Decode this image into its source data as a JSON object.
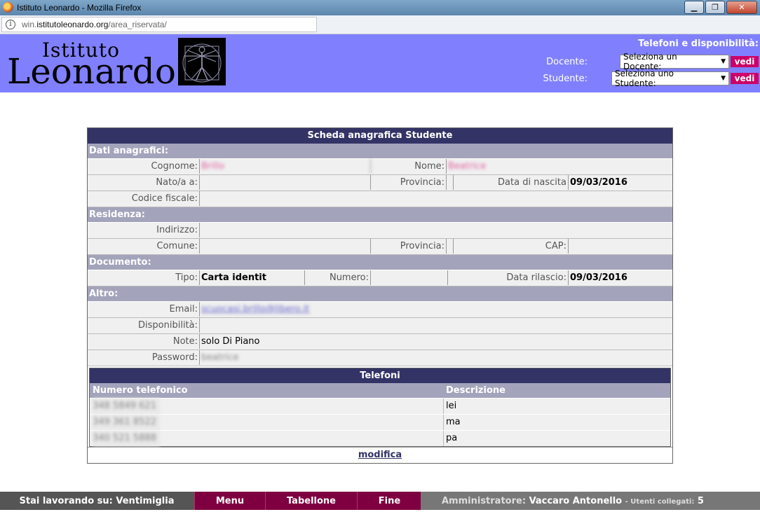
{
  "window": {
    "title": "Istituto Leonardo - Mozilla Firefox",
    "buttons": {
      "minimize": "▁",
      "maximize": "❐",
      "close": "✕"
    }
  },
  "addressbar": {
    "url_prefix": "win.",
    "url_domain": "istitutoleonardo.org",
    "url_path": "/area_riservata/"
  },
  "header": {
    "logo_line1": "Istituto",
    "logo_line2": "Leonardo",
    "title": "Telefoni e disponibilità:",
    "docente_label": "Docente:",
    "docente_select": "Seleziona un Docente:",
    "studente_label": "Studente:",
    "studente_select": "Seleziona uno Studente:",
    "vedi_label": "vedi"
  },
  "card": {
    "title": "Scheda anagrafica Studente",
    "sections": {
      "anagrafici": "Dati anagrafici:",
      "residenza": "Residenza:",
      "documento": "Documento:",
      "altro": "Altro:"
    },
    "labels": {
      "cognome": "Cognome:",
      "nome": "Nome:",
      "nato": "Nato/a a:",
      "provincia": "Provincia:",
      "data_nascita": "Data di nascita",
      "codice_fiscale": "Codice fiscale:",
      "indirizzo": "Indirizzo:",
      "comune": "Comune:",
      "cap": "CAP:",
      "tipo": "Tipo:",
      "numero": "Numero:",
      "data_rilascio": "Data rilascio:",
      "email": "Email:",
      "disponibilita": "Disponibilità:",
      "note": "Note:",
      "password": "Password:"
    },
    "values": {
      "cognome": "Brillo",
      "nome": "Beatrice",
      "data_nascita": "09/03/2016",
      "tipo": "Carta identit",
      "data_rilascio": "09/03/2016",
      "email": "scuocasi.brillo@libero.it",
      "note": "solo Di Piano",
      "password": "beatrice"
    },
    "phones": {
      "title": "Telefoni",
      "col_number": "Numero telefonico",
      "col_desc": "Descrizione",
      "rows": [
        {
          "number": "348 5849 621",
          "desc": "lei"
        },
        {
          "number": "349 361 8522",
          "desc": "ma"
        },
        {
          "number": "340 521 5888",
          "desc": "pa"
        }
      ]
    },
    "modifica": "modifica"
  },
  "footer": {
    "working_on_label": "Stai lavorando su:",
    "working_on_value": "Ventimiglia",
    "menu": "Menu",
    "tabellone": "Tabellone",
    "fine": "Fine",
    "role_label": "Amministratore:",
    "user_name": "Vaccaro Antonello",
    "connected_label": "- Utenti collegati:",
    "connected_count": "5"
  }
}
